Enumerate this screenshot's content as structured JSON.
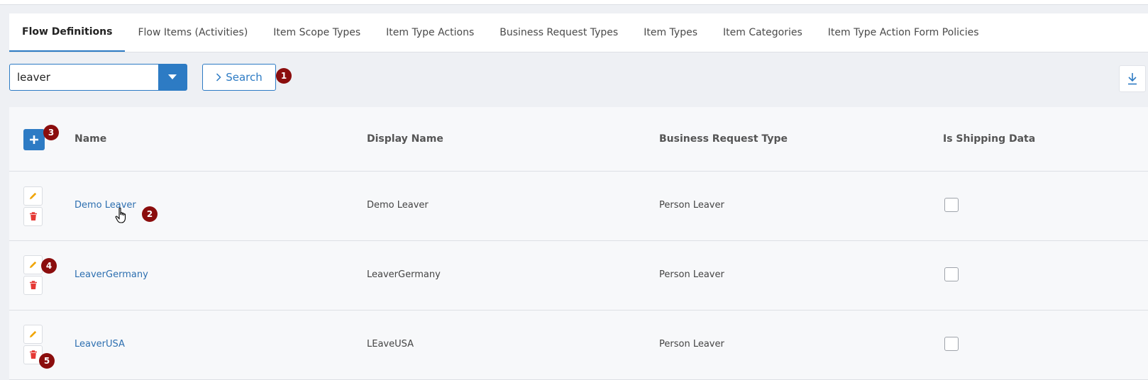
{
  "tabs": [
    {
      "label": "Flow Definitions",
      "active": true
    },
    {
      "label": "Flow Items (Activities)"
    },
    {
      "label": "Item Scope Types"
    },
    {
      "label": "Item Type Actions"
    },
    {
      "label": "Business Request Types"
    },
    {
      "label": "Item Types"
    },
    {
      "label": "Item Categories"
    },
    {
      "label": "Item Type Action Form Policies"
    }
  ],
  "search": {
    "value": "leaver",
    "button_label": "Search"
  },
  "table": {
    "headers": {
      "name": "Name",
      "display_name": "Display Name",
      "business_request_type": "Business Request Type",
      "is_shipping_data": "Is Shipping Data"
    },
    "rows": [
      {
        "name": "Demo Leaver",
        "display_name": "Demo Leaver",
        "business_request_type": "Person Leaver",
        "is_shipping_data": false
      },
      {
        "name": "LeaverGermany",
        "display_name": "LeaverGermany",
        "business_request_type": "Person Leaver",
        "is_shipping_data": false
      },
      {
        "name": "LeaverUSA",
        "display_name": "LEaveUSA",
        "business_request_type": "Person Leaver",
        "is_shipping_data": false
      }
    ]
  },
  "markers": [
    "1",
    "2",
    "3",
    "4",
    "5"
  ],
  "colors": {
    "accent": "#2d7bc4",
    "edit_icon": "#f0a400",
    "delete_icon": "#e53935",
    "marker": "#8b0d0d",
    "link": "#2d6fb0"
  },
  "icons": {
    "dropdown": "caret-down-icon",
    "search": "chevron-right-icon",
    "download": "download-icon",
    "add": "plus-icon",
    "edit": "pencil-icon",
    "delete": "trash-icon"
  }
}
